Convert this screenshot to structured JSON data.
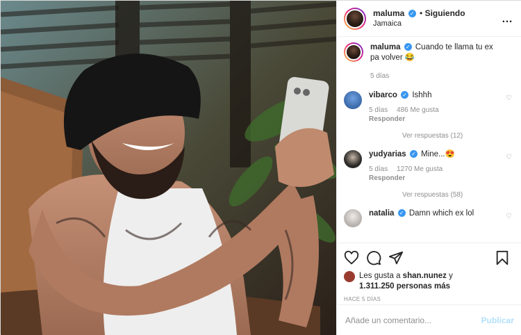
{
  "header": {
    "username": "maluma",
    "verified_mark": "✓",
    "separator": "•",
    "follow_status": "Siguiendo",
    "location": "Jamaica",
    "more_icon": "…"
  },
  "caption": {
    "username": "maluma",
    "text": "Cuando te llama tu ex pa volver 😂",
    "age": "5 días"
  },
  "comments": [
    {
      "username": "vibarco",
      "text": "Ishhh",
      "age": "5 días",
      "likes": "486 Me gusta",
      "reply": "Responder",
      "view_replies": "Ver respuestas (12)",
      "avatar_color": "#3d6fb6"
    },
    {
      "username": "yudyarias",
      "text": "Mine...😍",
      "age": "5 días",
      "likes": "1270 Me gusta",
      "reply": "Responder",
      "view_replies": "Ver respuestas (58)",
      "avatar_color": "#2c2a28"
    },
    {
      "username": "natalia",
      "text": "Damn which ex lol",
      "avatar_color": "#c9c4c0"
    }
  ],
  "likes": {
    "prefix": "Les gusta a",
    "user": "shan.nunez",
    "conj": "y",
    "others": "1.311.250 personas más"
  },
  "timestamp": "HACE 5 DÍAS",
  "add_comment": {
    "placeholder": "Añade un comentario...",
    "publish": "Publicar"
  },
  "colors": {
    "verified": "#3897f0",
    "publish": "#b2dffc",
    "muted": "#8e8e8e"
  },
  "icons": [
    "heart-icon",
    "comment-icon",
    "share-icon",
    "bookmark-icon",
    "more-icon"
  ]
}
